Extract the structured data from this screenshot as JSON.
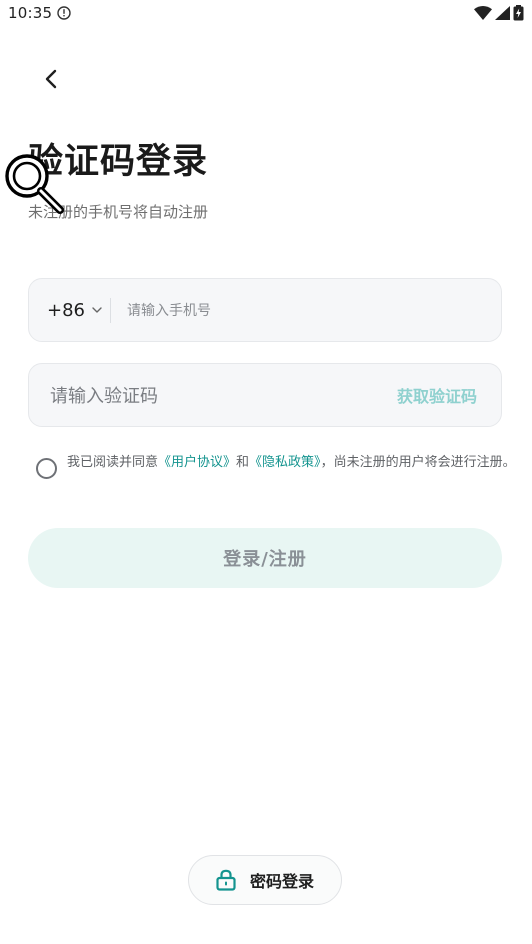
{
  "status_bar": {
    "time": "10:35",
    "alert_icon": "alert-circle-icon",
    "wifi_icon": "wifi-icon",
    "signal_icon": "cellular-signal-icon",
    "battery_icon": "battery-charging-icon"
  },
  "header": {
    "back_icon": "chevron-left-icon",
    "title": "验证码登录",
    "subtitle": "未注册的手机号将自动注册"
  },
  "phone_field": {
    "country_code": "+86",
    "placeholder": "请输入手机号",
    "value": ""
  },
  "code_field": {
    "placeholder": "请输入验证码",
    "value": "",
    "get_code_label": "获取验证码"
  },
  "agreement": {
    "checked": false,
    "prefix": "我已阅读并同意",
    "user_agreement": "《用户协议》",
    "conjunction": "和",
    "privacy_policy": "《隐私政策》",
    "suffix": "，尚未注册的用户将会进行注册。"
  },
  "login_button": {
    "label": "登录/注册"
  },
  "password_login": {
    "icon": "lock-icon",
    "label": "密码登录"
  },
  "colors": {
    "accent": "#14948f",
    "button_bg": "#e8f6f3",
    "button_text": "#8a9096",
    "get_code": "#8fd1cf"
  }
}
